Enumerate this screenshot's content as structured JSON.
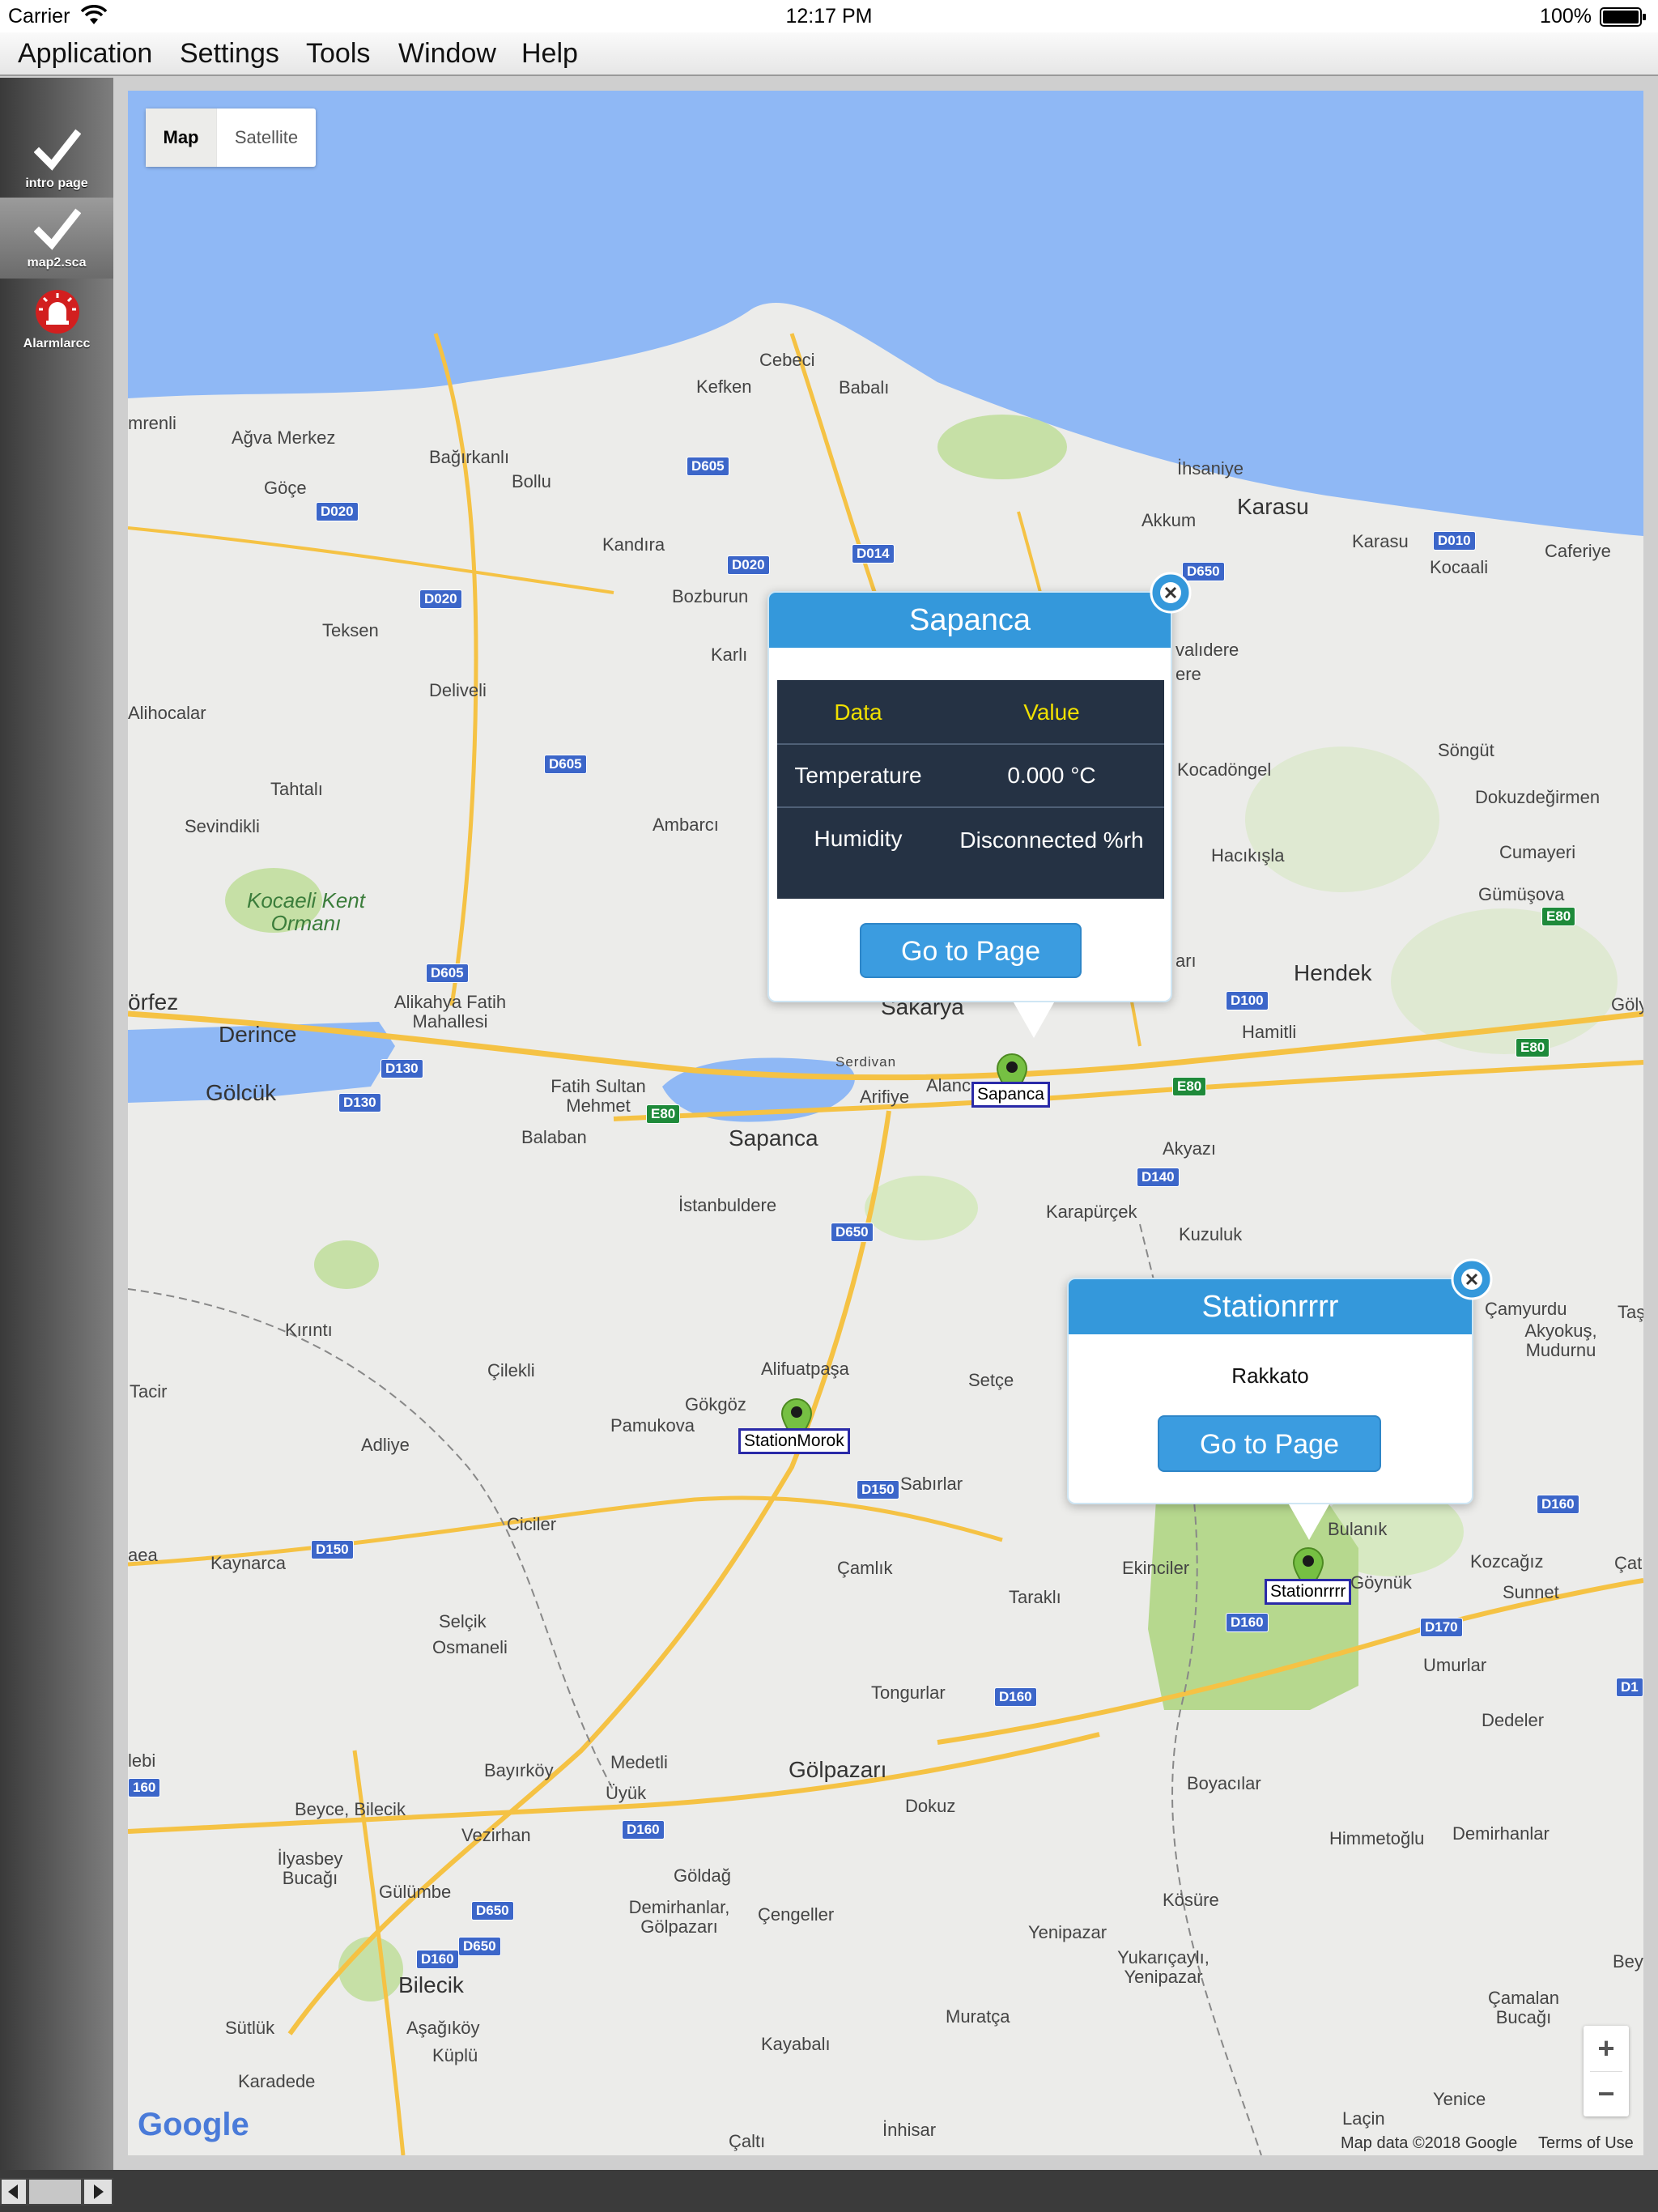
{
  "status_bar": {
    "carrier": "Carrier",
    "time": "12:17 PM",
    "battery": "100%"
  },
  "menu": [
    "Application",
    "Settings",
    "Tools",
    "Window",
    "Help"
  ],
  "sidebar": {
    "items": [
      {
        "label": "intro page",
        "icon": "checkmark-icon"
      },
      {
        "label": "map2.sca",
        "icon": "checkmark-icon"
      },
      {
        "label": "Alarmlarcc",
        "icon": "alarm-siren-icon"
      }
    ]
  },
  "map": {
    "type_options": {
      "map": "Map",
      "satellite": "Satellite"
    },
    "labels": [
      "Cebeci",
      "Kefken",
      "Babalı",
      "mrenli",
      "Ağva Merkez",
      "Bağırkanlı",
      "Göçe",
      "Bollu",
      "Kandıra",
      "İhsaniye",
      "Akkum",
      "Karasu",
      "Karasu",
      "Kocaali",
      "Caferiye",
      "Bozburun",
      "Teksen",
      "Karlı",
      "Deliveli",
      "Alihocalar",
      "Tahtalı",
      "Sevindikli",
      "Ambarcı",
      "Kocadöngel",
      "Söngüt",
      "Dokuzdeğirmen",
      "Cumayeri",
      "Gümüşova",
      "Hacıkışla",
      "Hendek",
      "Gölya",
      "Hamitli",
      "Alikahya Fatih Mahallesi",
      "Fatih Sultan Mehmet",
      "Serdivan",
      "Arifiye",
      "Alanc",
      "Balaban",
      "Akyazı",
      "İstanbuldere",
      "Karapürçek",
      "Kuzuluk",
      "Kırıntı",
      "Çilekli",
      "Alifuatpaşa",
      "Setçe",
      "Gökgöz",
      "Pamukova",
      "Sabırlar",
      "Tacir",
      "Adliye",
      "Ciciler",
      "aea",
      "Kaynarca",
      "Çamlık",
      "Taraklı",
      "Ekinciler",
      "Bulanık",
      "Göynük",
      "Kozcağız",
      "Sunnet",
      "Çat",
      "Selçik",
      "Osmaneli",
      "Tongurlar",
      "Umurlar",
      "Dedeler",
      "lebi",
      "Bayırköy",
      "Medetli",
      "Üyük",
      "Gölpazarı",
      "Dokuz",
      "Boyacılar",
      "Beyce, Bilecik",
      "Vezirhan",
      "Himmetoğlu",
      "Demirhanlar",
      "İlyasbey Bucağı",
      "Gülümbe",
      "Göldağ",
      "Demirhanlar, Gölpazarı",
      "Çengeller",
      "Kösüre",
      "Yenipazar",
      "Yukarıçaylı, Yenipazar",
      "Bey",
      "Bilecik",
      "Aşağıköy",
      "Küplü",
      "Sütlük",
      "Karadede",
      "Kayabalı",
      "Muratça",
      "Çamalan Bucağı",
      "Yenice",
      "Laçin",
      "İnhisar",
      "Çaltı",
      "Çamyurdu",
      "Akyokuş, Mudurnu",
      "Taş",
      "valıdere",
      "ere",
      "arı",
      "örfez",
      "Derince",
      "Gölcük",
      "Sakarya",
      "Sapanca",
      "Kocaeli Kent Ormanı"
    ],
    "roads": [
      "D605",
      "D020",
      "D020",
      "D020",
      "D014",
      "D650",
      "D010",
      "D605",
      "D605",
      "D130",
      "D130",
      "E80",
      "E80",
      "D100",
      "E80",
      "D140",
      "D650",
      "D150",
      "D150",
      "D160",
      "D160",
      "D160",
      "D650",
      "D160",
      "D650",
      "D160",
      "D170",
      "D1",
      "E80",
      "160"
    ],
    "footer": {
      "map_data": "Map data ©2018 Google",
      "terms": "Terms of Use"
    },
    "google_logo": "Google",
    "zoom": {
      "in": "+",
      "out": "−"
    },
    "markers": [
      {
        "label": "Sapanca"
      },
      {
        "label": "StationMorok"
      },
      {
        "label": "Stationrrrr"
      }
    ]
  },
  "popups": {
    "sapanca": {
      "title": "Sapanca",
      "table": {
        "headers": [
          "Data",
          "Value"
        ],
        "rows": [
          {
            "data": "Temperature",
            "value": "0.000 °C"
          },
          {
            "data": "Humidity",
            "value": "Disconnected %rh"
          }
        ]
      },
      "button": "Go to Page"
    },
    "station": {
      "title": "Stationrrrr",
      "subtitle": "Rakkato",
      "button": "Go to Page"
    }
  },
  "colors": {
    "accent": "#3498db",
    "sea": "#8fb8f5",
    "land": "#ececea",
    "park": "#c6e0a6",
    "marker": "#76c043"
  }
}
